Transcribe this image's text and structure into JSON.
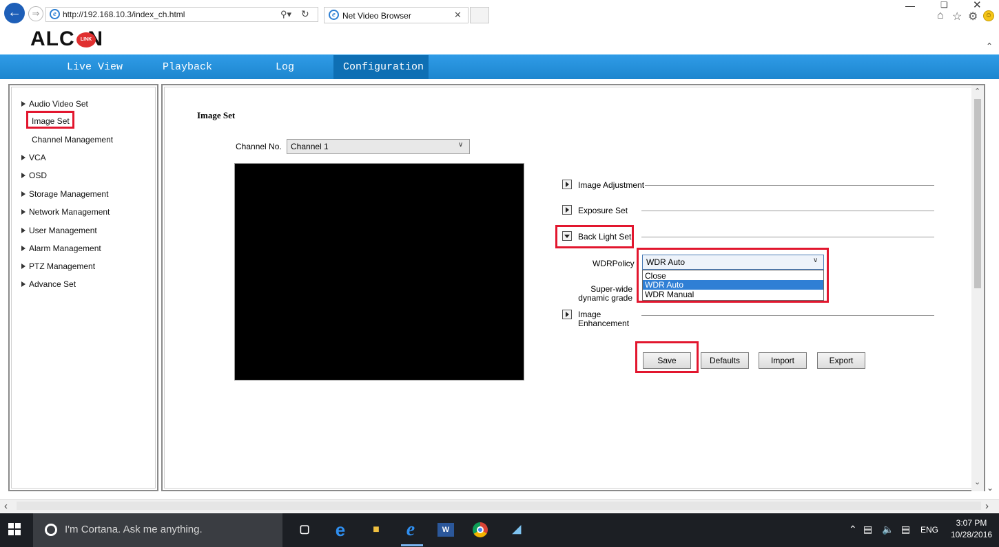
{
  "browser": {
    "url": "http://192.168.10.3/index_ch.html",
    "tab_title": "Net Video Browser",
    "back_icon": "back-arrow-icon",
    "forward_icon": "forward-arrow-icon",
    "search_icon": "search-icon",
    "refresh_icon": "refresh-icon",
    "close_tab_icon": "close-icon"
  },
  "app": {
    "logo_text": "ALC  N",
    "logo_badge": "LINK"
  },
  "nav": {
    "live_view": "Live View",
    "playback": "Playback",
    "log": "Log",
    "configuration": "Configuration",
    "active": "Configuration",
    "color": "#2391dc"
  },
  "sidebar": {
    "items": [
      {
        "label": "Audio Video Set",
        "expandable": true
      },
      {
        "label": "Image Set",
        "expandable": false,
        "highlighted": true
      },
      {
        "label": "Channel Management",
        "expandable": false
      },
      {
        "label": "VCA",
        "expandable": true
      },
      {
        "label": "OSD",
        "expandable": true
      },
      {
        "label": "Storage Management",
        "expandable": true
      },
      {
        "label": "Network Management",
        "expandable": true
      },
      {
        "label": "User Management",
        "expandable": true
      },
      {
        "label": "Alarm Management",
        "expandable": true
      },
      {
        "label": "PTZ Management",
        "expandable": true
      },
      {
        "label": "Advance Set",
        "expandable": true
      }
    ]
  },
  "main": {
    "title": "Image Set",
    "channel_label": "Channel No.",
    "channel_value": "Channel 1",
    "sections": {
      "image_adjustment": "Image Adjustment",
      "exposure_set": "Exposure Set",
      "back_light_set": "Back Light Set",
      "image_enhancement": "Image Enhancement"
    },
    "wdr_label": "WDRPolicy",
    "wdr_value": "WDR Auto",
    "wdr_options": [
      "Close",
      "WDR Auto",
      "WDR Manual"
    ],
    "wdr_selected": "WDR Auto",
    "superwide_label": "Super-wide dynamic grade",
    "buttons": {
      "save": "Save",
      "defaults": "Defaults",
      "import": "Import",
      "export": "Export"
    },
    "highlight_color": "#e2162e"
  },
  "taskbar": {
    "cortana_placeholder": "I'm Cortana. Ask me anything.",
    "language": "ENG",
    "time": "3:07 PM",
    "date": "10/28/2016"
  }
}
